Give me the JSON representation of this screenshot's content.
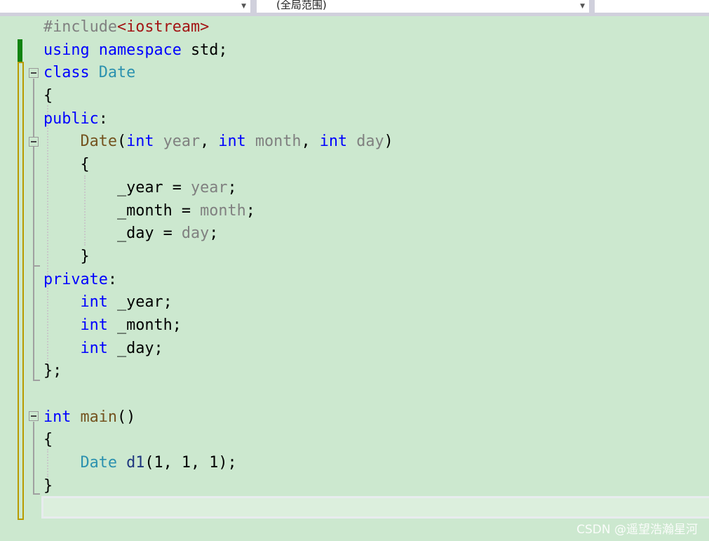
{
  "toolbar": {
    "left_dropdown": "",
    "scope_dropdown": "(全局范围)"
  },
  "code": [
    [
      {
        "t": "#include",
        "c": "pre"
      },
      {
        "t": "<iostream>",
        "c": "s"
      }
    ],
    [
      {
        "t": "using",
        "c": "k"
      },
      {
        "t": " "
      },
      {
        "t": "namespace",
        "c": "k"
      },
      {
        "t": " std;"
      }
    ],
    [
      {
        "t": "class",
        "c": "k"
      },
      {
        "t": " "
      },
      {
        "t": "Date",
        "c": "t"
      }
    ],
    [
      {
        "t": "{"
      }
    ],
    [
      {
        "t": "public",
        "c": "k"
      },
      {
        "t": ":"
      }
    ],
    [
      {
        "t": "    "
      },
      {
        "t": "Date",
        "c": "f"
      },
      {
        "t": "("
      },
      {
        "t": "int",
        "c": "k"
      },
      {
        "t": " "
      },
      {
        "t": "year",
        "c": "p"
      },
      {
        "t": ", "
      },
      {
        "t": "int",
        "c": "k"
      },
      {
        "t": " "
      },
      {
        "t": "month",
        "c": "p"
      },
      {
        "t": ", "
      },
      {
        "t": "int",
        "c": "k"
      },
      {
        "t": " "
      },
      {
        "t": "day",
        "c": "p"
      },
      {
        "t": ")"
      }
    ],
    [
      {
        "t": "    {"
      }
    ],
    [
      {
        "t": "        _year = "
      },
      {
        "t": "year",
        "c": "p"
      },
      {
        "t": ";"
      }
    ],
    [
      {
        "t": "        _month = "
      },
      {
        "t": "month",
        "c": "p"
      },
      {
        "t": ";"
      }
    ],
    [
      {
        "t": "        _day = "
      },
      {
        "t": "day",
        "c": "p"
      },
      {
        "t": ";"
      }
    ],
    [
      {
        "t": "    }"
      }
    ],
    [
      {
        "t": "private",
        "c": "k"
      },
      {
        "t": ":"
      }
    ],
    [
      {
        "t": "    "
      },
      {
        "t": "int",
        "c": "k"
      },
      {
        "t": " _year;"
      }
    ],
    [
      {
        "t": "    "
      },
      {
        "t": "int",
        "c": "k"
      },
      {
        "t": " _month;"
      }
    ],
    [
      {
        "t": "    "
      },
      {
        "t": "int",
        "c": "k"
      },
      {
        "t": " _day;"
      }
    ],
    [
      {
        "t": "};"
      }
    ],
    [
      {
        "t": ""
      }
    ],
    [
      {
        "t": "int",
        "c": "k"
      },
      {
        "t": " "
      },
      {
        "t": "main",
        "c": "f"
      },
      {
        "t": "()"
      }
    ],
    [
      {
        "t": "{"
      }
    ],
    [
      {
        "t": "    "
      },
      {
        "t": "Date",
        "c": "t"
      },
      {
        "t": " "
      },
      {
        "t": "d1",
        "c": "v"
      },
      {
        "t": "(1, 1, 1);"
      }
    ],
    [
      {
        "t": "}"
      }
    ]
  ],
  "watermark": "CSDN @遥望浩瀚星河"
}
